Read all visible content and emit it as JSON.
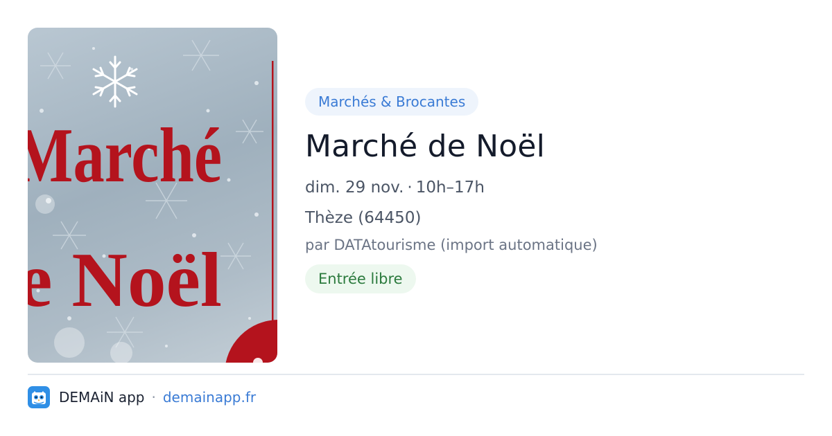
{
  "event": {
    "image": {
      "poster_text_line1": "Marché",
      "poster_text_line2": "e Noël"
    },
    "category": "Marchés & Brocantes",
    "title": "Marché de Noël",
    "date": "dim. 29 nov.",
    "date_separator": "·",
    "time": "10h–17h",
    "place": "Thèze (64450)",
    "source": "par DATAtourisme (import automatique)",
    "price": "Entrée libre"
  },
  "footer": {
    "app_name": "DEMAiN app",
    "separator": "·",
    "url": "demainapp.fr",
    "logo_icon": "owl-icon"
  },
  "colors": {
    "accent": "#3a7bd5",
    "category_bg": "#eef4fc",
    "price_fg": "#2b7a3d",
    "price_bg": "#edf8ef",
    "poster_red": "#b4131d",
    "logo_bg": "#2f8fe6"
  }
}
